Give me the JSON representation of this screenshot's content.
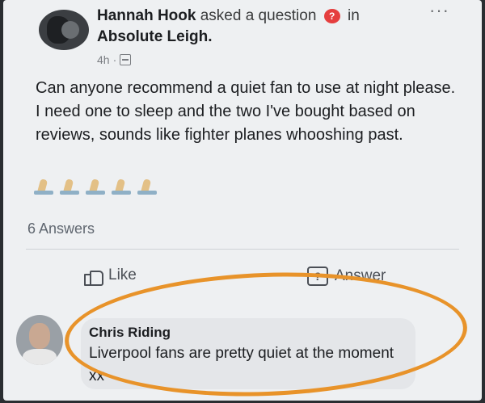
{
  "post": {
    "author": "Hannah Hook",
    "action_text": "asked a question",
    "in_text": "in",
    "group": "Absolute Leigh.",
    "time": "4h",
    "separator": "·",
    "body": "Can anyone recommend a quiet fan to use at night please. I need one to sleep and the two I've bought based on reviews, sounds like fighter planes whooshing past.",
    "more_label": "···",
    "question_badge": "?"
  },
  "answers": {
    "count_label": "6 Answers"
  },
  "actions": {
    "like_label": "Like",
    "answer_label": "Answer",
    "answer_icon_glyph": "?"
  },
  "comment": {
    "author": "Chris Riding",
    "text": "Liverpool fans are pretty quiet at the moment xx"
  },
  "colors": {
    "highlight": "#e8932a",
    "question_badge": "#e53e3e"
  }
}
